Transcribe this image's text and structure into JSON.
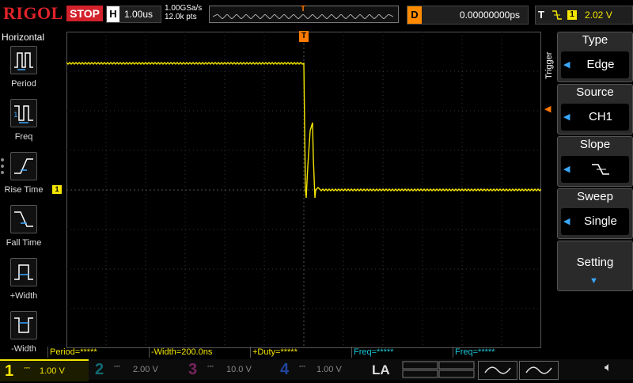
{
  "brand": "RIGOL",
  "run_state": "STOP",
  "horizontal": {
    "label": "H",
    "timebase": "1.00us",
    "sample_rate": "1.00GSa/s",
    "mem_pts": "12.0k pts"
  },
  "delay": {
    "label": "D",
    "value": "0.00000000ps"
  },
  "trigger": {
    "label": "T",
    "source_num": "1",
    "level": "2.02 V",
    "marker": "T"
  },
  "left_menu": {
    "title": "Horizontal",
    "items": [
      {
        "label": "Period"
      },
      {
        "label": "Freq"
      },
      {
        "label": "Rise Time"
      },
      {
        "label": "Fall Time"
      },
      {
        "label": "+Width"
      },
      {
        "label": "-Width"
      }
    ]
  },
  "right_menu": {
    "side_title": "Trigger",
    "type": {
      "title": "Type",
      "value": "Edge"
    },
    "source": {
      "title": "Source",
      "value": "CH1"
    },
    "slope": {
      "title": "Slope",
      "value": "falling-edge-icon"
    },
    "sweep": {
      "title": "Sweep",
      "value": "Single"
    },
    "setting": {
      "title": "Setting"
    }
  },
  "measurements": [
    "Period=*****",
    "-Width=200.0ns",
    "+Duty=*****",
    "Freq=*****",
    "Freq=*****"
  ],
  "channels": [
    {
      "num": "1",
      "scale": "1.00 V",
      "color": "#f5e600"
    },
    {
      "num": "2",
      "scale": "2.00 V",
      "color": "#19c6d8"
    },
    {
      "num": "3",
      "scale": "10.0 V",
      "color": "#e23db0"
    },
    {
      "num": "4",
      "scale": "1.00 V",
      "color": "#2e6cff"
    }
  ],
  "la_label": "LA",
  "channel1_marker": "1",
  "colors": {
    "ch1": "#f5e600",
    "trigger": "#ff7a00",
    "stop": "#d3222b"
  }
}
